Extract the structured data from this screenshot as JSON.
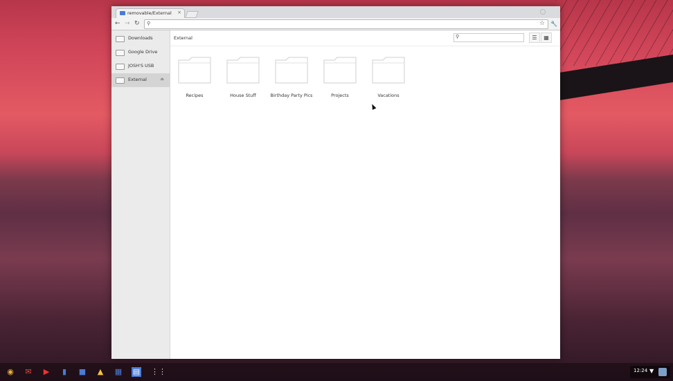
{
  "browser": {
    "tab_title": "removable/External",
    "tab_close": "×",
    "url": ""
  },
  "sidebar": {
    "items": [
      {
        "label": "Downloads"
      },
      {
        "label": "Google Drive"
      },
      {
        "label": "JOSH'S USB"
      },
      {
        "label": "External",
        "eject": "⏏"
      }
    ]
  },
  "header": {
    "breadcrumb": "External",
    "search_placeholder": ""
  },
  "folders": [
    {
      "label": "Recipes"
    },
    {
      "label": "House Stuff"
    },
    {
      "label": "Birthday Party Pics"
    },
    {
      "label": "Projects"
    },
    {
      "label": "Vacations"
    }
  ],
  "shelf": {
    "clock": "12:24"
  },
  "colors": {
    "accent": "#4a7bd5",
    "folder_stroke": "#cfcfcf"
  }
}
